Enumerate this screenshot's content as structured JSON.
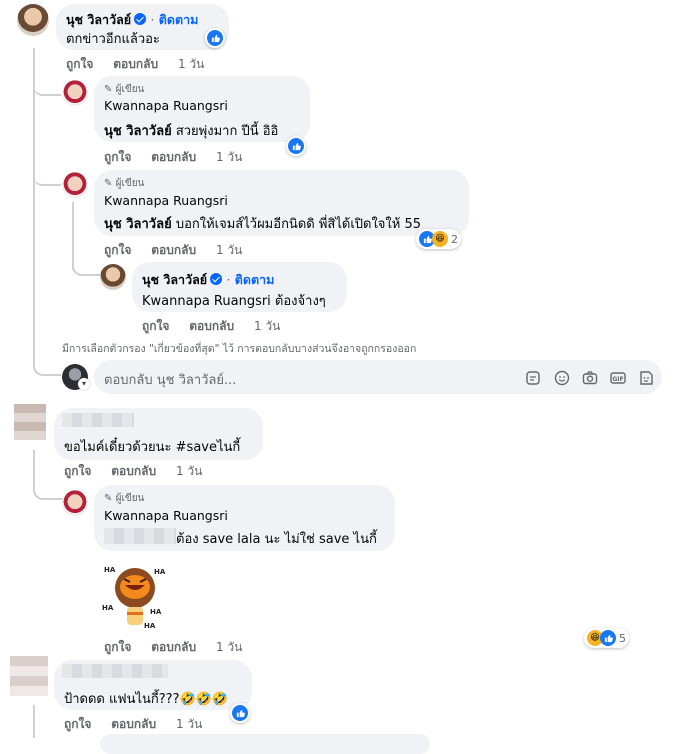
{
  "common": {
    "like": "ถูกใจ",
    "reply": "ตอบกลับ",
    "time": "1 วัน",
    "follow": "ติดตาม",
    "author_tag": "ผู้เขียน",
    "dot": "·"
  },
  "c1": {
    "name": "นุช วิลาวัลย์",
    "text": "ตกข่าวอีกแล้วอะ"
  },
  "r1": {
    "name": "Kwannapa Ruangsri",
    "mention": "นุช วิลาวัลย์",
    "text": " สวยพุ่งมาก ปีนี้ อิอิ"
  },
  "r2": {
    "name": "Kwannapa Ruangsri",
    "mention": "นุช วิลาวัลย์",
    "text": " บอกให้เจมส์ไว้ผมอีกนิดดิ พี่สิได้เปิดใจให้ 55",
    "reaction_count": "2"
  },
  "r3": {
    "name": "นุช วิลาวัลย์",
    "mention": "Kwannapa Ruangsri",
    "text": " ต้องจ้างๆ"
  },
  "filter_notice": "มีการเลือกตัวกรอง \"เกี่ยวข้องที่สุด\" ไว้ การตอบกลับบางส่วนจึงอาจถูกกรองออก",
  "reply_box": {
    "placeholder": "ตอบกลับ นุช วิลาวัลย์..."
  },
  "c2": {
    "text": "ขอไมค์เดี๋ยวด้วยนะ #saveไนกี้"
  },
  "r4": {
    "name": "Kwannapa Ruangsri",
    "text": " ต้อง save lala นะ ไม่ใช่ save ไนกี้",
    "reaction_count": "5"
  },
  "c3": {
    "text": "ป้าดดด แฟนไนกี้???"
  },
  "colors": {
    "bubble": "#f0f2f5",
    "secondary_text": "#65676b",
    "link_blue": "#0866ff",
    "like_blue": "#1877f2",
    "haha_yellow": "#f7b125"
  },
  "icons": [
    "pencil-icon",
    "verified-badge-icon",
    "like-reaction-icon",
    "haha-reaction-icon",
    "sticker-icon",
    "emoji-icon",
    "camera-icon",
    "gif-icon",
    "avatar-sticker-icon"
  ]
}
